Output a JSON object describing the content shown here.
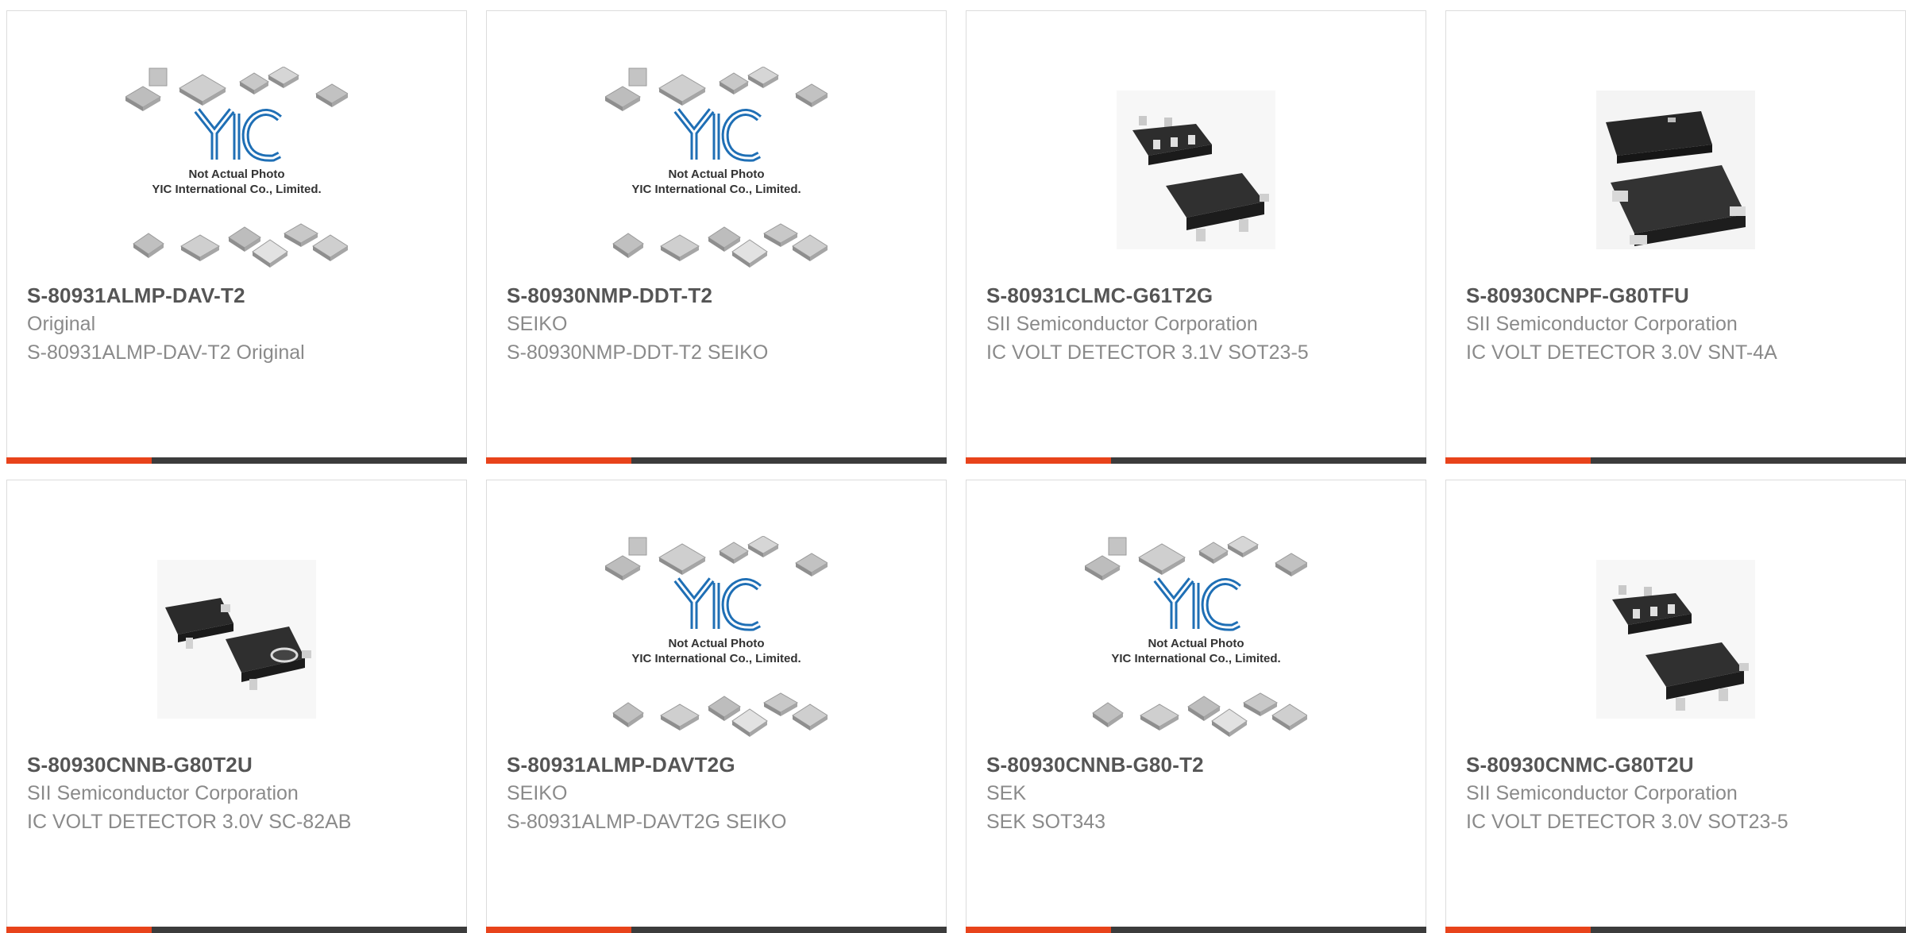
{
  "products": [
    {
      "part_number": "S-80931ALMP-DAV-T2",
      "manufacturer": "Original",
      "description": "S-80931ALMP-DAV-T2 Original",
      "image_type": "placeholder",
      "placeholder_text1": "Not Actual Photo",
      "placeholder_text2": "YIC International Co., Limited."
    },
    {
      "part_number": "S-80930NMP-DDT-T2",
      "manufacturer": "SEIKO",
      "description": "S-80930NMP-DDT-T2 SEIKO",
      "image_type": "placeholder",
      "placeholder_text1": "Not Actual Photo",
      "placeholder_text2": "YIC International Co., Limited."
    },
    {
      "part_number": "S-80931CLMC-G61T2G",
      "manufacturer": "SII Semiconductor Corporation",
      "description": "IC VOLT DETECTOR 3.1V SOT23-5",
      "image_type": "sot23-5"
    },
    {
      "part_number": "S-80930CNPF-G80TFU",
      "manufacturer": "SII Semiconductor Corporation",
      "description": "IC VOLT DETECTOR 3.0V SNT-4A",
      "image_type": "snt-4a"
    },
    {
      "part_number": "S-80930CNNB-G80T2U",
      "manufacturer": "SII Semiconductor Corporation",
      "description": "IC VOLT DETECTOR 3.0V SC-82AB",
      "image_type": "sc-82ab"
    },
    {
      "part_number": "S-80931ALMP-DAVT2G",
      "manufacturer": "SEIKO",
      "description": "S-80931ALMP-DAVT2G SEIKO",
      "image_type": "placeholder",
      "placeholder_text1": "Not Actual Photo",
      "placeholder_text2": "YIC International Co., Limited."
    },
    {
      "part_number": "S-80930CNNB-G80-T2",
      "manufacturer": "SEK",
      "description": "SEK SOT343",
      "image_type": "placeholder",
      "placeholder_text1": "Not Actual Photo",
      "placeholder_text2": "YIC International Co., Limited."
    },
    {
      "part_number": "S-80930CNMC-G80T2U",
      "manufacturer": "SII Semiconductor Corporation",
      "description": "IC VOLT DETECTOR 3.0V SOT23-5",
      "image_type": "sot23-5"
    }
  ],
  "colors": {
    "accent": "#e8431b",
    "bar": "#3c3c3c",
    "part_number": "#555555",
    "meta_text": "#8a8a8a",
    "logo_blue": "#1f6fb5"
  }
}
